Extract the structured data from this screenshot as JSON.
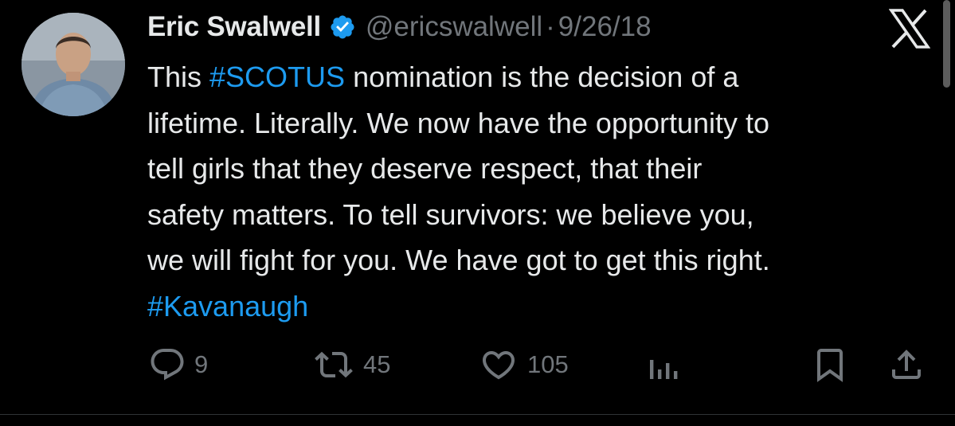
{
  "tweet": {
    "display_name": "Eric Swalwell",
    "verified": true,
    "handle": "@ericswalwell",
    "separator": "·",
    "date": "9/26/18",
    "body_lines": [
      [
        {
          "text": "This "
        },
        {
          "text": "#SCOTUS",
          "hashtag": true
        },
        {
          "text": " nomination is the decision of a"
        }
      ],
      [
        {
          "text": "lifetime. Literally. We now have the opportunity to"
        }
      ],
      [
        {
          "text": "tell girls that they deserve respect, that their"
        }
      ],
      [
        {
          "text": "safety matters. To tell survivors: we believe you,"
        }
      ],
      [
        {
          "text": "we will fight for you. We have got to get this right."
        }
      ],
      [
        {
          "text": "#Kavanaugh",
          "hashtag": true
        }
      ]
    ]
  },
  "actions": {
    "replies": "9",
    "retweets": "45",
    "likes": "105"
  },
  "icons": {
    "avatar": "avatar-photo",
    "verified": "verified-badge-icon",
    "x_logo": "x-logo-icon",
    "reply": "reply-icon",
    "retweet": "retweet-icon",
    "like": "heart-icon",
    "views": "analytics-icon",
    "bookmark": "bookmark-icon",
    "share": "share-icon"
  },
  "colors": {
    "background": "#000000",
    "text": "#e7e9ea",
    "secondary": "#71767b",
    "link": "#1d9bf0"
  }
}
